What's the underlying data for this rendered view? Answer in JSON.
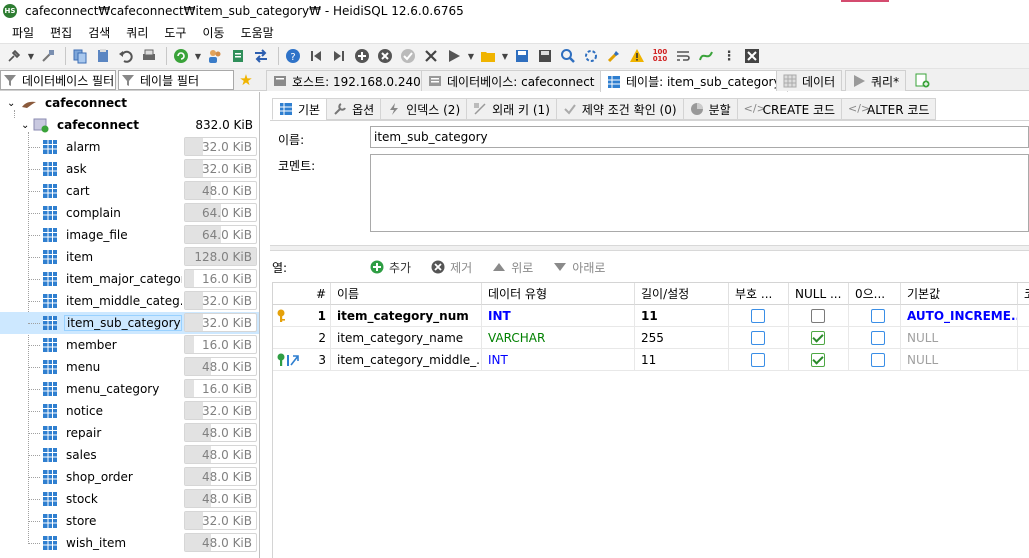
{
  "window": {
    "title": "cafeconnect₩cafeconnect₩item_sub_category₩ - HeidiSQL 12.6.0.6765",
    "app_badge": "HS"
  },
  "menu": [
    "파일",
    "편집",
    "검색",
    "쿼리",
    "도구",
    "이동",
    "도움말"
  ],
  "filters": {
    "db_filter": "데이터베이스 필터",
    "table_filter": "테이블 필터"
  },
  "main_tabs": [
    {
      "label": "호스트: 192.168.0.240"
    },
    {
      "label": "데이터베이스: cafeconnect"
    },
    {
      "label": "테이블: item_sub_category"
    },
    {
      "label": "데이터"
    },
    {
      "label": "쿼리*"
    }
  ],
  "tree": {
    "server": "cafeconnect",
    "database": {
      "name": "cafeconnect",
      "size": "832.0 KiB"
    },
    "tables": [
      {
        "name": "alarm",
        "size": "32.0 KiB",
        "fill": 0.25
      },
      {
        "name": "ask",
        "size": "32.0 KiB",
        "fill": 0.25
      },
      {
        "name": "cart",
        "size": "48.0 KiB",
        "fill": 0.37
      },
      {
        "name": "complain",
        "size": "64.0 KiB",
        "fill": 0.5
      },
      {
        "name": "image_file",
        "size": "64.0 KiB",
        "fill": 0.5
      },
      {
        "name": "item",
        "size": "128.0 KiB",
        "fill": 1.0
      },
      {
        "name": "item_major_category",
        "size": "16.0 KiB",
        "fill": 0.12
      },
      {
        "name": "item_middle_categ...",
        "size": "32.0 KiB",
        "fill": 0.25
      },
      {
        "name": "item_sub_category",
        "size": "32.0 KiB",
        "fill": 0.25,
        "selected": true
      },
      {
        "name": "member",
        "size": "16.0 KiB",
        "fill": 0.12
      },
      {
        "name": "menu",
        "size": "48.0 KiB",
        "fill": 0.37
      },
      {
        "name": "menu_category",
        "size": "16.0 KiB",
        "fill": 0.12
      },
      {
        "name": "notice",
        "size": "32.0 KiB",
        "fill": 0.25
      },
      {
        "name": "repair",
        "size": "48.0 KiB",
        "fill": 0.37
      },
      {
        "name": "sales",
        "size": "48.0 KiB",
        "fill": 0.37
      },
      {
        "name": "shop_order",
        "size": "48.0 KiB",
        "fill": 0.37
      },
      {
        "name": "stock",
        "size": "48.0 KiB",
        "fill": 0.37
      },
      {
        "name": "store",
        "size": "32.0 KiB",
        "fill": 0.25
      },
      {
        "name": "wish_item",
        "size": "48.0 KiB",
        "fill": 0.37
      }
    ]
  },
  "subtabs": [
    "기본",
    "옵션",
    "인덱스 (2)",
    "외래 키 (1)",
    "제약 조건 확인 (0)",
    "분할",
    "CREATE 코드",
    "ALTER 코드"
  ],
  "form": {
    "name_label": "이름:",
    "name_value": "item_sub_category",
    "comment_label": "코멘트:"
  },
  "columns_bar": {
    "label": "열:",
    "add": "추가",
    "remove": "제거",
    "up": "위로",
    "down": "아래로"
  },
  "grid": {
    "headers": [
      "#",
      "이름",
      "데이터 유형",
      "길이/설정",
      "부호 ...",
      "NULL ...",
      "0으...",
      "기본값",
      "코"
    ],
    "rows": [
      {
        "num": "1",
        "name": "item_category_num",
        "type": "INT",
        "length": "11",
        "unsigned": false,
        "allow_null": false,
        "zerofill": false,
        "default": "AUTO_INCREME...",
        "bold": true
      },
      {
        "num": "2",
        "name": "item_category_name",
        "type": "VARCHAR",
        "length": "255",
        "unsigned": false,
        "allow_null": true,
        "zerofill": false,
        "default": "NULL"
      },
      {
        "num": "3",
        "name": "item_category_middle_...",
        "type": "INT",
        "length": "11",
        "unsigned": false,
        "allow_null": true,
        "zerofill": false,
        "default": "NULL"
      }
    ]
  },
  "colors": {
    "selection": "#cde8ff",
    "int_type": "#0000ff",
    "varchar_type": "#008000",
    "null_default": "#a0a0a0",
    "auto_inc": "#0000ff"
  }
}
